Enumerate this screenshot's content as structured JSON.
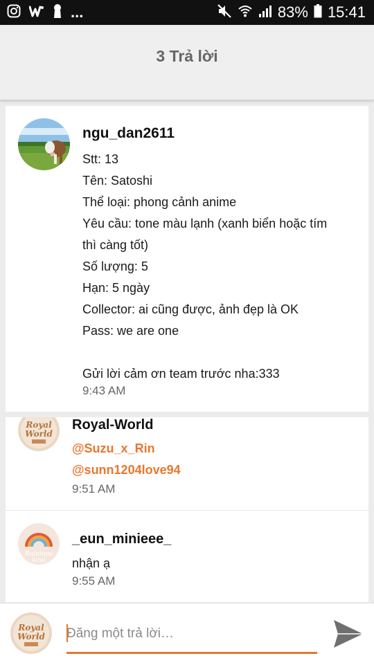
{
  "status_bar": {
    "battery": "83%",
    "time": "15:41",
    "more": "..."
  },
  "header": {
    "title": "3 Trả lời"
  },
  "post": {
    "username": "ngu_dan2611",
    "lines": [
      "Stt: 13",
      "Tên: Satoshi",
      "Thể loại: phong cảnh anime",
      "Yêu cầu: tone màu lạnh (xanh biển hoặc tím",
      "thì càng tốt)",
      "Số lượng: 5",
      "Hạn: 5 ngày",
      "Collector: ai cũng được, ảnh đẹp là OK",
      "Pass: we are one",
      "",
      "Gửi lời cảm ơn team trước nha:333"
    ],
    "time": "9:43 AM"
  },
  "replies": [
    {
      "username": "Royal-World",
      "mentions": [
        "@Suzu_x_Rin",
        "@sunn1204love94"
      ],
      "time": "9:51 AM",
      "avatar_text": "Royal World"
    },
    {
      "username": "_eun_minieee_",
      "text": "nhận ạ",
      "time": "9:55 AM",
      "avatar_text": "Rainbow land"
    }
  ],
  "compose": {
    "placeholder": "Đăng một trả lời…",
    "avatar_text": "Royal World"
  },
  "colors": {
    "accent": "#e8772e",
    "header_bg": "#efefef",
    "status_bar_bg": "#111111"
  },
  "icons": [
    "instagram-icon",
    "wattpad-icon",
    "keyhole-icon",
    "mute-icon",
    "wifi-icon",
    "signal-icon",
    "battery-icon",
    "send-icon"
  ]
}
